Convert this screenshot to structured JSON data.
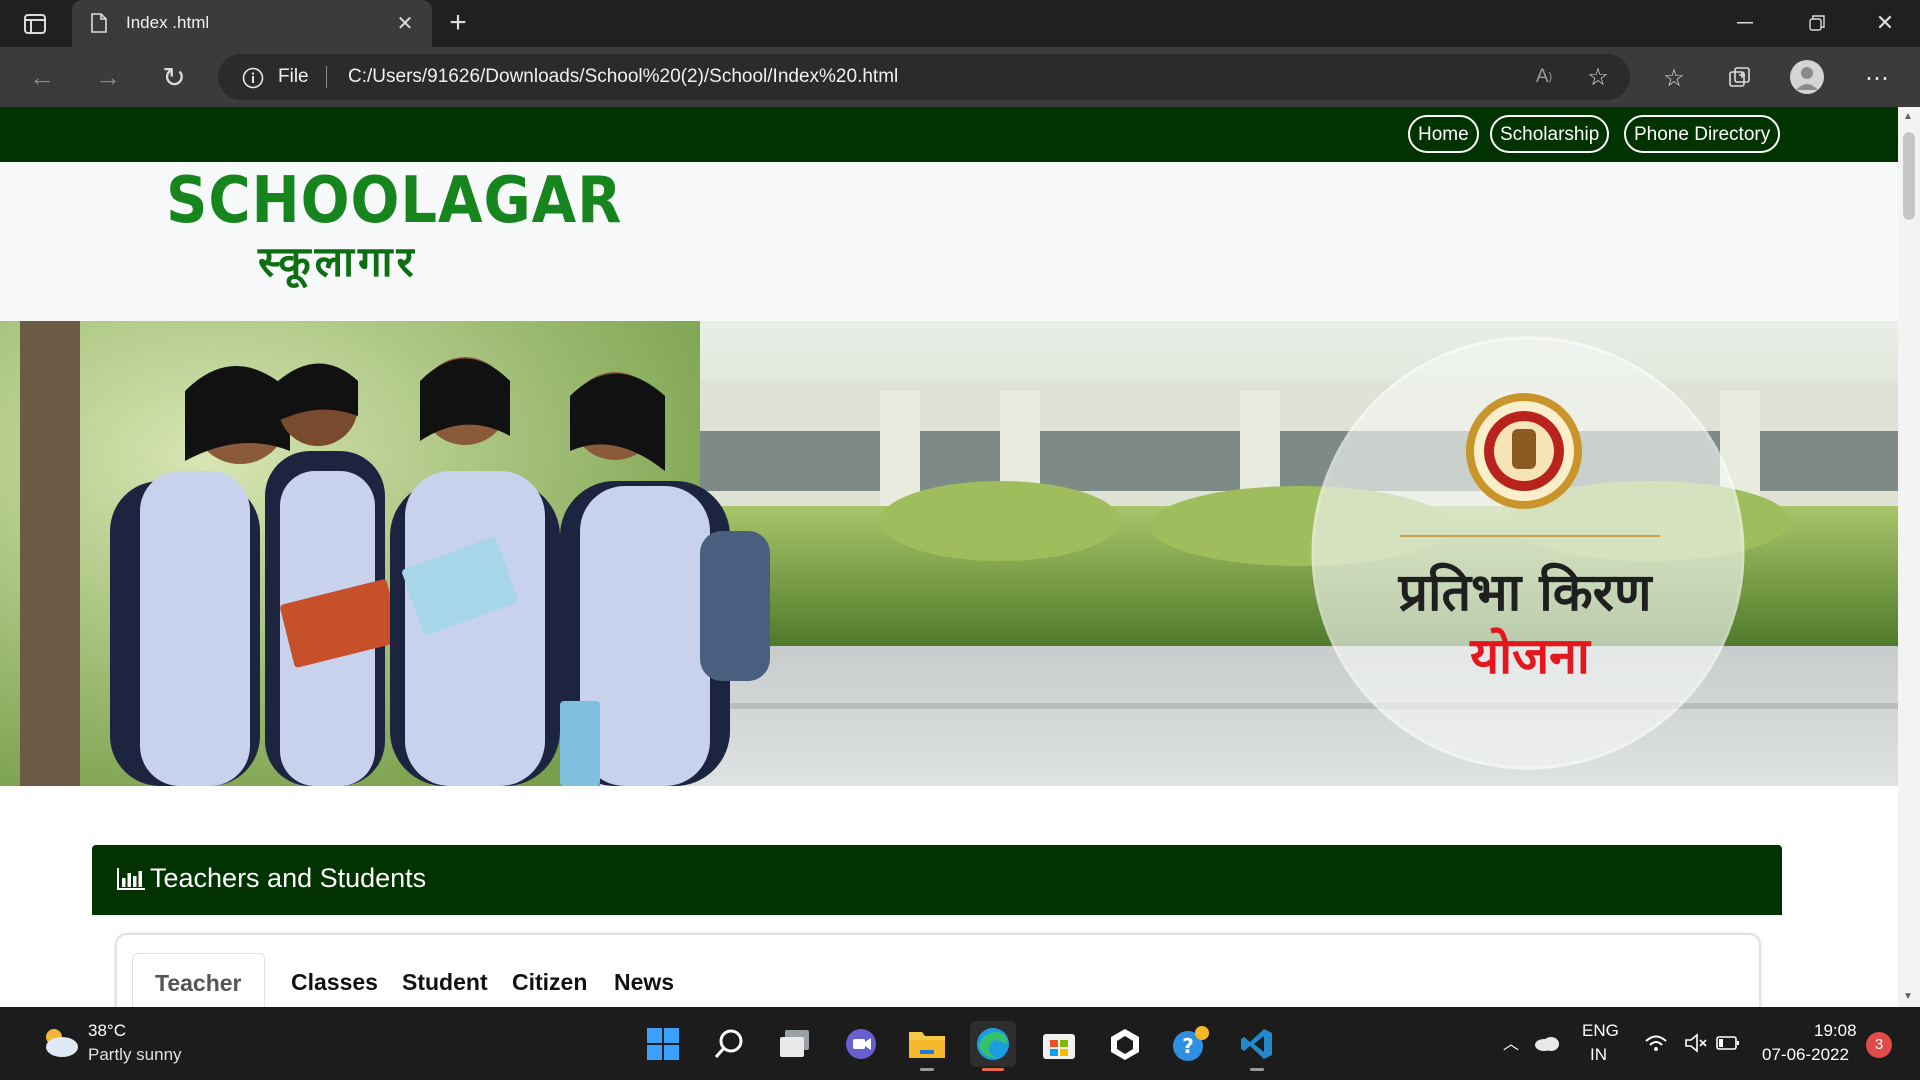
{
  "browser": {
    "tab_title": "Index .html",
    "address_scheme": "File",
    "address_url": "C:/Users/91626/Downloads/School%20(2)/School/Index%20.html"
  },
  "topnav": {
    "links": [
      "Home",
      "Scholarship",
      "Phone Directory"
    ]
  },
  "header": {
    "logo_en": "SCHOOLAGAR",
    "logo_hi": "स्कूलागार"
  },
  "banner": {
    "title_line1": "प्रतिभा किरण",
    "title_line2": "योजना"
  },
  "panel": {
    "title": "Teachers and Students",
    "tabs": [
      "Teacher",
      "Classes",
      "Student",
      "Citizen",
      "News"
    ],
    "active_tab": "Teacher"
  },
  "taskbar": {
    "weather_temp": "38°C",
    "weather_desc": "Partly sunny",
    "lang_line1": "ENG",
    "lang_line2": "IN",
    "time": "19:08",
    "date": "07-06-2022",
    "notification_count": "3"
  },
  "colors": {
    "nav_green": "#003300",
    "logo_green": "#17851e",
    "yojana_red": "#e3171d"
  }
}
